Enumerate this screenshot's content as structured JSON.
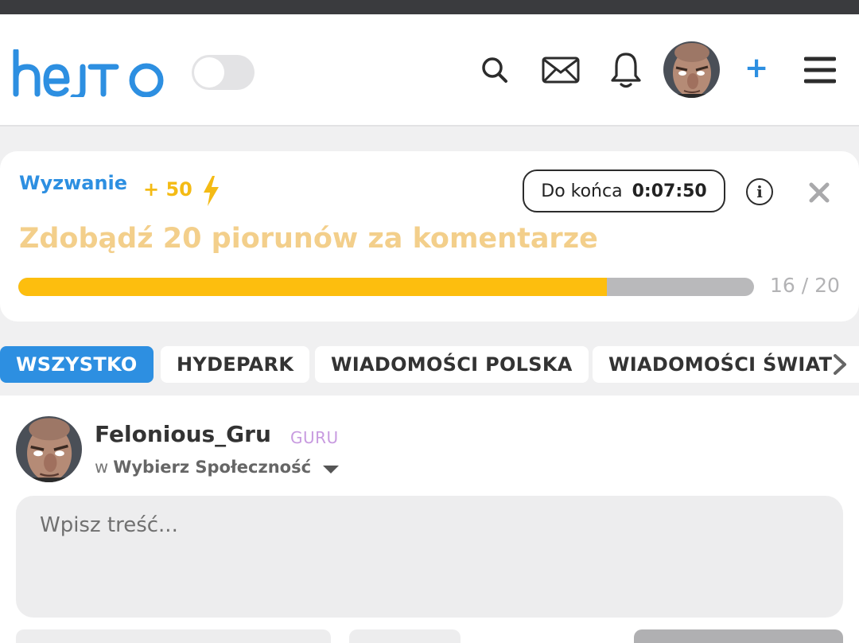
{
  "header": {
    "logo_text": "hejto",
    "brand_color": "#2d8fe1",
    "icons": [
      "search-icon",
      "mail-icon",
      "bell-icon",
      "avatar",
      "plus-icon",
      "menu-icon"
    ],
    "plus_label": "+"
  },
  "challenge": {
    "label": "Wyzwanie",
    "points": "+ 50",
    "timer_label": "Do końca",
    "timer_value": "0:07:50",
    "title": "Zdobądź 20 piorunów za komentarze",
    "progress_current": 16,
    "progress_total": 20,
    "progress_text": "16 / 20",
    "info_glyph": "i",
    "colors": {
      "label": "#2d8fe1",
      "points": "#f4bb15",
      "title": "#f3cf8b",
      "fill": "#fdbe0e",
      "track": "#b9b9bb"
    }
  },
  "tabs": [
    {
      "label": "WSZYSTKO",
      "active": true
    },
    {
      "label": "HYDEPARK",
      "active": false
    },
    {
      "label": "WIADOMOŚCI POLSKA",
      "active": false
    },
    {
      "label": "WIADOMOŚCI ŚWIAT",
      "active": false
    }
  ],
  "composer": {
    "username": "Felonious_Gru",
    "rank": "GURU",
    "community_prefix": "w",
    "community_label": "Wybierz Społeczność",
    "placeholder": "Wpisz treść..."
  }
}
